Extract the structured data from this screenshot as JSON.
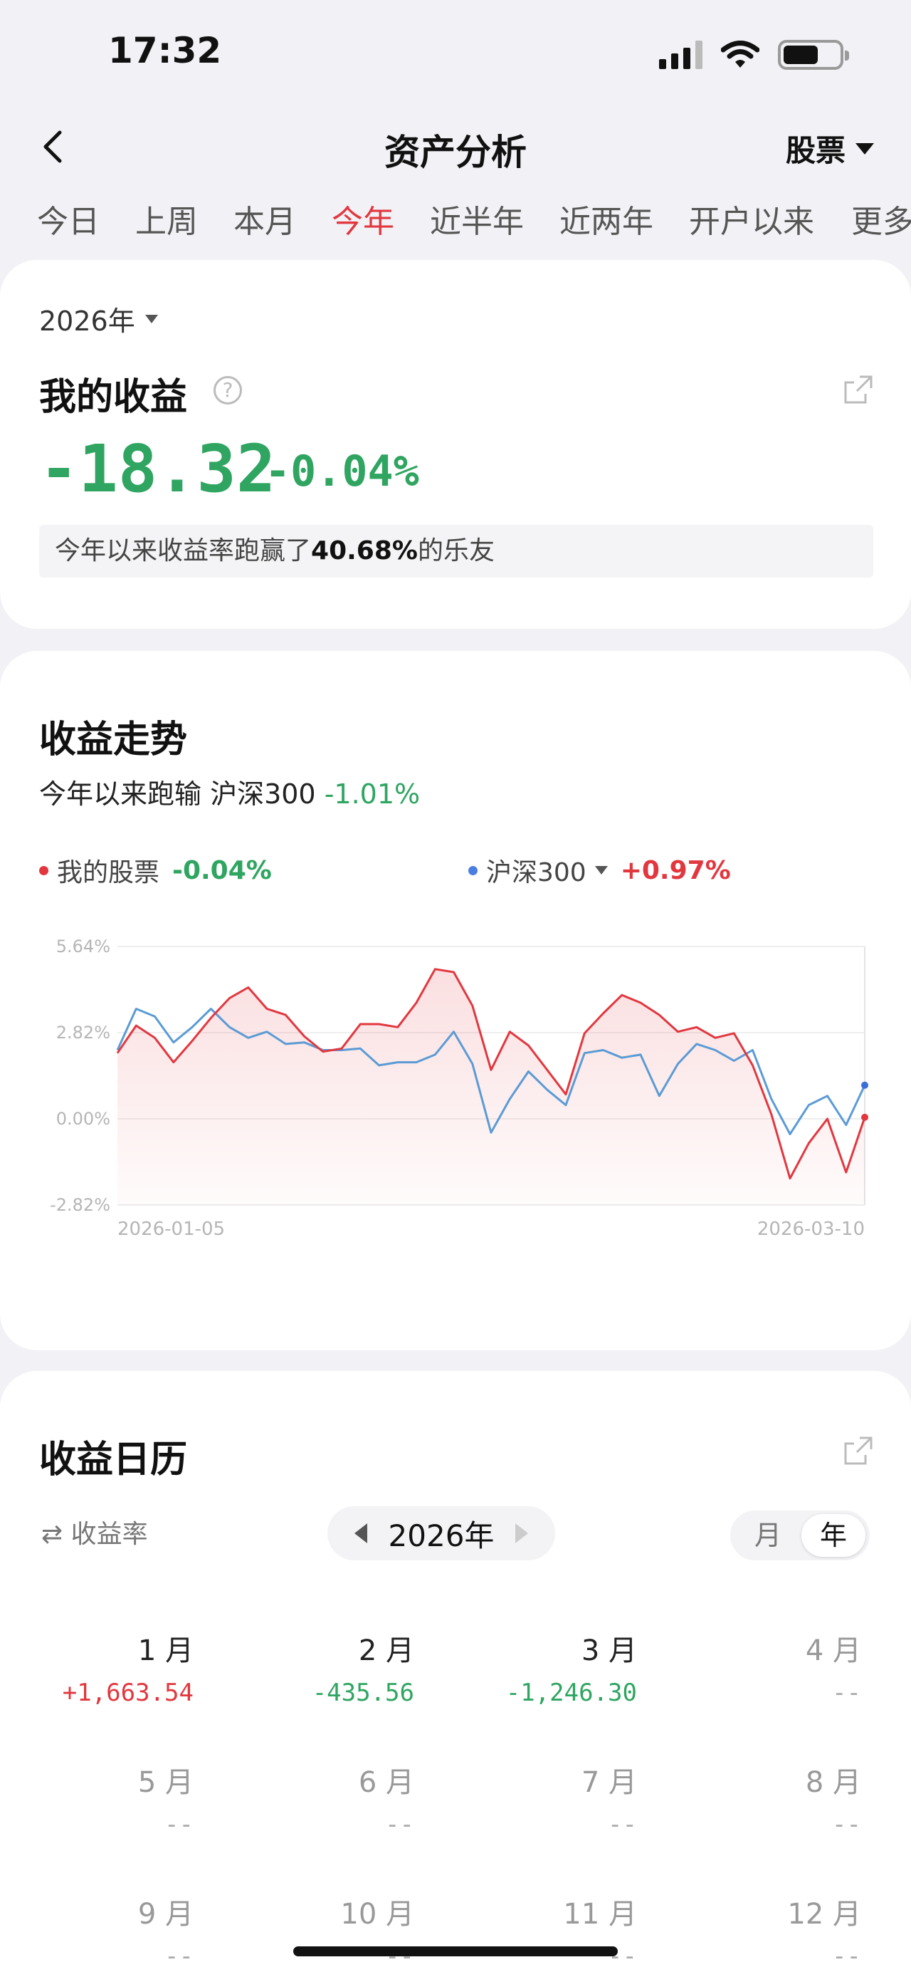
{
  "status": {
    "time": "17:32"
  },
  "nav": {
    "title": "资产分析",
    "filter": "股票"
  },
  "periods": [
    "今日",
    "上周",
    "本月",
    "今年",
    "近半年",
    "近两年",
    "开户以来",
    "更多"
  ],
  "income": {
    "year": "2026年",
    "title": "我的收益",
    "help": "?",
    "value": "-18.32",
    "rate": "-0.04%",
    "rank_prefix": "今年以来收益率跑赢了",
    "rank_value": "40.68%",
    "rank_suffix": "的乐友"
  },
  "trend": {
    "title": "收益走势",
    "subtitle_prefix": "今年以来跑输 沪深300",
    "subtitle_value": "-1.01%",
    "legend": [
      {
        "label": "我的股票",
        "value": "-0.04%"
      },
      {
        "label": "沪深300",
        "value": "+0.97%"
      }
    ]
  },
  "colors": {
    "mine": "#e2373f",
    "index": "#5b9bd5",
    "green": "#2fa561",
    "red": "#e2373f"
  },
  "chart_data": {
    "type": "line",
    "y_ticks": [
      "5.64%",
      "2.82%",
      "0.00%",
      "-2.82%"
    ],
    "ylim": [
      -2.82,
      5.64
    ],
    "x_labels": [
      "2026-01-05",
      "2026-03-10"
    ],
    "grid": true,
    "series": [
      {
        "name": "我的股票",
        "color": "#e2373f",
        "fill": true,
        "values": [
          2.15,
          3.05,
          2.65,
          1.85,
          2.55,
          3.3,
          3.95,
          4.3,
          3.6,
          3.4,
          2.7,
          2.2,
          2.3,
          3.1,
          3.1,
          3.0,
          3.8,
          4.9,
          4.8,
          3.7,
          1.6,
          2.85,
          2.4,
          1.6,
          0.8,
          2.8,
          3.45,
          4.05,
          3.8,
          3.4,
          2.85,
          3.0,
          2.65,
          2.8,
          1.75,
          0.15,
          -1.95,
          -0.8,
          0.0,
          -1.75,
          0.05
        ]
      },
      {
        "name": "沪深300",
        "color": "#5b9bd5",
        "fill": false,
        "values": [
          2.25,
          3.6,
          3.35,
          2.5,
          3.0,
          3.6,
          3.0,
          2.65,
          2.85,
          2.45,
          2.5,
          2.25,
          2.25,
          2.3,
          1.75,
          1.85,
          1.85,
          2.1,
          2.85,
          1.8,
          -0.45,
          0.65,
          1.55,
          0.95,
          0.45,
          2.15,
          2.25,
          2.0,
          2.1,
          0.75,
          1.8,
          2.45,
          2.25,
          1.9,
          2.25,
          0.65,
          -0.5,
          0.45,
          0.75,
          -0.2,
          1.1
        ]
      }
    ]
  },
  "calendar": {
    "title": "收益日历",
    "toggle_label": "⇄ 收益率",
    "year": "2026年",
    "view_month": "月",
    "view_year": "年",
    "months": [
      {
        "name": "1 月",
        "value": "+1,663.54",
        "state": "pos"
      },
      {
        "name": "2 月",
        "value": "-435.56",
        "state": "neg"
      },
      {
        "name": "3 月",
        "value": "-1,246.30",
        "state": "neg"
      },
      {
        "name": "4 月",
        "value": "--",
        "state": "none"
      },
      {
        "name": "5 月",
        "value": "--",
        "state": "none"
      },
      {
        "name": "6 月",
        "value": "--",
        "state": "none"
      },
      {
        "name": "7 月",
        "value": "--",
        "state": "none"
      },
      {
        "name": "8 月",
        "value": "--",
        "state": "none"
      },
      {
        "name": "9 月",
        "value": "--",
        "state": "none"
      },
      {
        "name": "10 月",
        "value": "--",
        "state": "none"
      },
      {
        "name": "11 月",
        "value": "--",
        "state": "none"
      },
      {
        "name": "12 月",
        "value": "--",
        "state": "none"
      }
    ]
  }
}
